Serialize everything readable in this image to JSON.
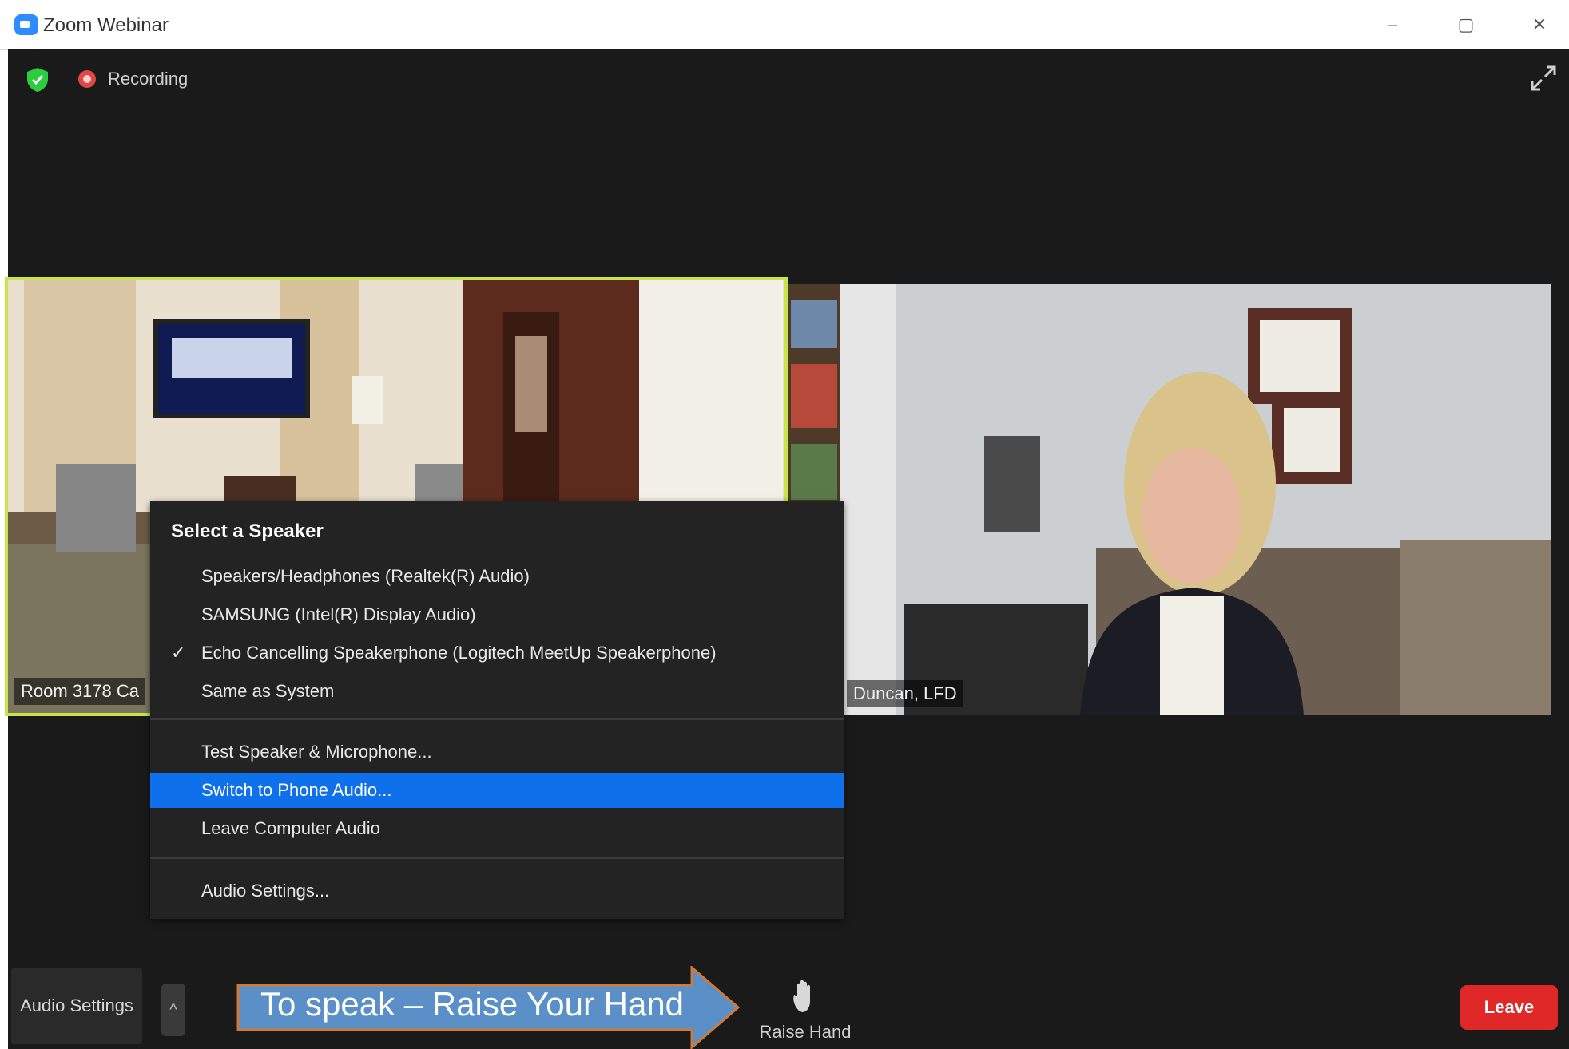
{
  "window": {
    "title": "Zoom Webinar",
    "controls": {
      "minimize": "–",
      "maximize": "▢",
      "close": "✕"
    }
  },
  "topbar": {
    "recording_label": "Recording",
    "icons": {
      "security": "shield-check-icon",
      "recording": "recording-dot-icon",
      "fullscreen": "expand-icon"
    }
  },
  "videos": [
    {
      "name": "Room 3178 Ca",
      "active_speaker": true
    },
    {
      "name": "Duncan, LFD",
      "active_speaker": false
    }
  ],
  "audio_menu": {
    "header": "Select a Speaker",
    "speakers": [
      {
        "label": "Speakers/Headphones (Realtek(R) Audio)",
        "checked": false
      },
      {
        "label": "SAMSUNG (Intel(R) Display Audio)",
        "checked": false
      },
      {
        "label": "Echo Cancelling Speakerphone (Logitech MeetUp Speakerphone)",
        "checked": true
      },
      {
        "label": "Same as System",
        "checked": false
      }
    ],
    "actions": [
      {
        "label": "Test Speaker & Microphone...",
        "highlighted": false
      },
      {
        "label": "Switch to Phone Audio...",
        "highlighted": true
      },
      {
        "label": "Leave Computer Audio",
        "highlighted": false
      }
    ],
    "settings": "Audio Settings..."
  },
  "bottombar": {
    "audio_settings_label": "Audio Settings",
    "callout": "To speak – Raise Your Hand",
    "raise_hand_label": "Raise Hand",
    "leave_label": "Leave"
  },
  "colors": {
    "accent_blue": "#0e71eb",
    "active_speaker_border": "#c7e44b",
    "leave_red": "#e02828",
    "callout_blue": "#5b8fc7"
  }
}
